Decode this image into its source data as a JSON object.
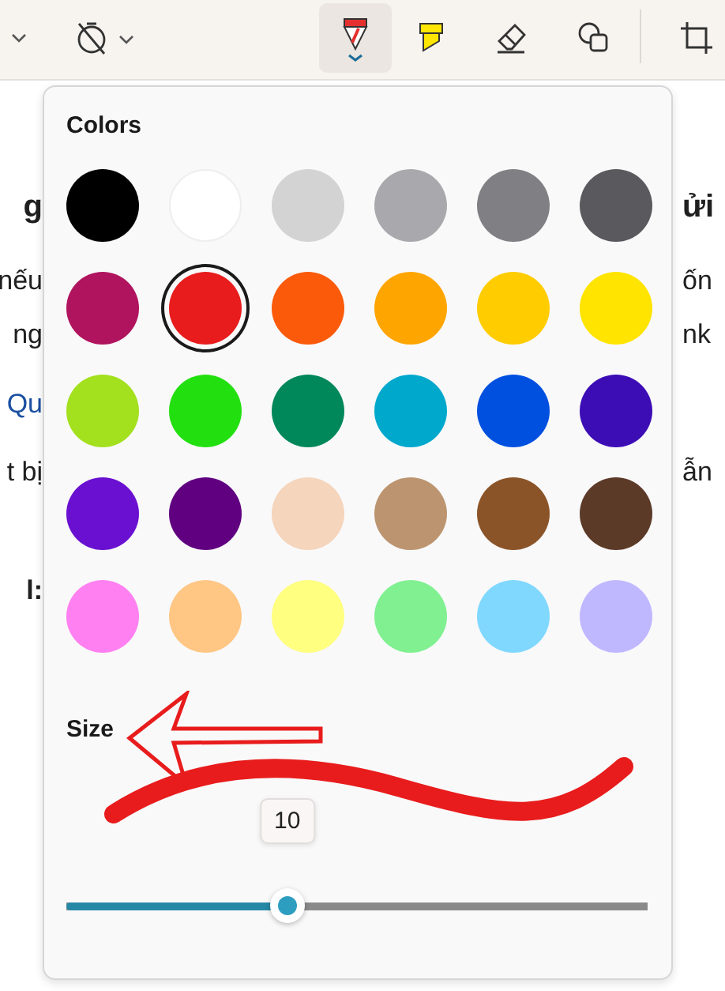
{
  "toolbar": {
    "tools": [
      {
        "kind": "chevron",
        "selected": false
      },
      {
        "kind": "timer-off",
        "selected": false
      },
      {
        "kind": "pen",
        "selected": true
      },
      {
        "kind": "highlighter",
        "selected": false
      },
      {
        "kind": "eraser",
        "selected": false
      },
      {
        "kind": "shapes",
        "selected": false
      },
      {
        "kind": "crop",
        "selected": false
      }
    ]
  },
  "background_text": {
    "left": [
      {
        "text": "g",
        "kind": "heading"
      },
      {
        "text": "nếu",
        "kind": "body"
      },
      {
        "text": "ng",
        "kind": "body"
      },
      {
        "text": "Qu",
        "kind": "link"
      },
      {
        "text": "t bị",
        "kind": "body"
      },
      {
        "text": "l:",
        "kind": "label"
      }
    ],
    "right": [
      {
        "text": "ửi",
        "kind": "heading"
      },
      {
        "text": "ốn",
        "kind": "body"
      },
      {
        "text": "nk",
        "kind": "body"
      },
      {
        "text": "ẫn",
        "kind": "body"
      }
    ]
  },
  "colors_panel": {
    "title": "Colors",
    "colors": [
      {
        "color": "#000000",
        "selected": false
      },
      {
        "color": "#ffffff",
        "selected": false
      },
      {
        "color": "#d3d3d3",
        "selected": false
      },
      {
        "color": "#a9a9ad",
        "selected": false
      },
      {
        "color": "#808084",
        "selected": false
      },
      {
        "color": "#5a5a5e",
        "selected": false
      },
      {
        "color": "#b0145e",
        "selected": false
      },
      {
        "color": "#e81c1c",
        "selected": true
      },
      {
        "color": "#fa5a0a",
        "selected": false
      },
      {
        "color": "#ffa500",
        "selected": false
      },
      {
        "color": "#ffcc00",
        "selected": false
      },
      {
        "color": "#ffe400",
        "selected": false
      },
      {
        "color": "#a3e01e",
        "selected": false
      },
      {
        "color": "#22e00f",
        "selected": false
      },
      {
        "color": "#00875a",
        "selected": false
      },
      {
        "color": "#00a8cc",
        "selected": false
      },
      {
        "color": "#0050e0",
        "selected": false
      },
      {
        "color": "#3c0cb5",
        "selected": false
      },
      {
        "color": "#6a10d0",
        "selected": false
      },
      {
        "color": "#600080",
        "selected": false
      },
      {
        "color": "#f5d5bc",
        "selected": false
      },
      {
        "color": "#bc9570",
        "selected": false
      },
      {
        "color": "#8b5428",
        "selected": false
      },
      {
        "color": "#5c3a28",
        "selected": false
      },
      {
        "color": "#ff80f0",
        "selected": false
      },
      {
        "color": "#ffc684",
        "selected": false
      },
      {
        "color": "#ffff80",
        "selected": false
      },
      {
        "color": "#80f090",
        "selected": false
      },
      {
        "color": "#80d8ff",
        "selected": false
      },
      {
        "color": "#c0b8ff",
        "selected": false
      }
    ],
    "size_label": "Size",
    "size_tooltip": "10",
    "size": {
      "level": 0.38
    }
  }
}
